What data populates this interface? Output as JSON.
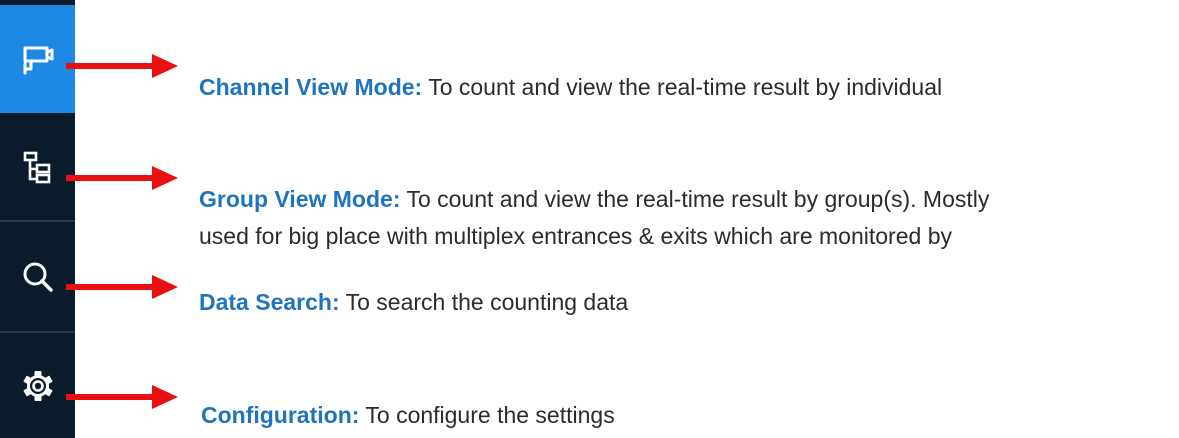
{
  "sidebar": {
    "items": [
      {
        "icon": "camera-icon",
        "active": true
      },
      {
        "icon": "group-tree-icon",
        "active": false
      },
      {
        "icon": "search-icon",
        "active": false
      },
      {
        "icon": "gear-icon",
        "active": false
      }
    ]
  },
  "annotations": [
    {
      "term": "Channel View Mode:",
      "text": " To count and view the real-time result by individual"
    },
    {
      "term": "Group View Mode:",
      "text": " To count and view the real-time result by group(s). Mostly",
      "line2": "used for big place with multiplex entrances & exits which are monitored by"
    },
    {
      "term": "Data Search:",
      "text": " To search the counting data"
    },
    {
      "term": "Configuration:",
      "text": " To configure the settings"
    }
  ],
  "colors": {
    "sidebar_bg": "#0b1b2b",
    "active_bg": "#1e88e5",
    "arrow": "#e81010",
    "term": "#1f74bf",
    "text": "#2b2b2b"
  }
}
